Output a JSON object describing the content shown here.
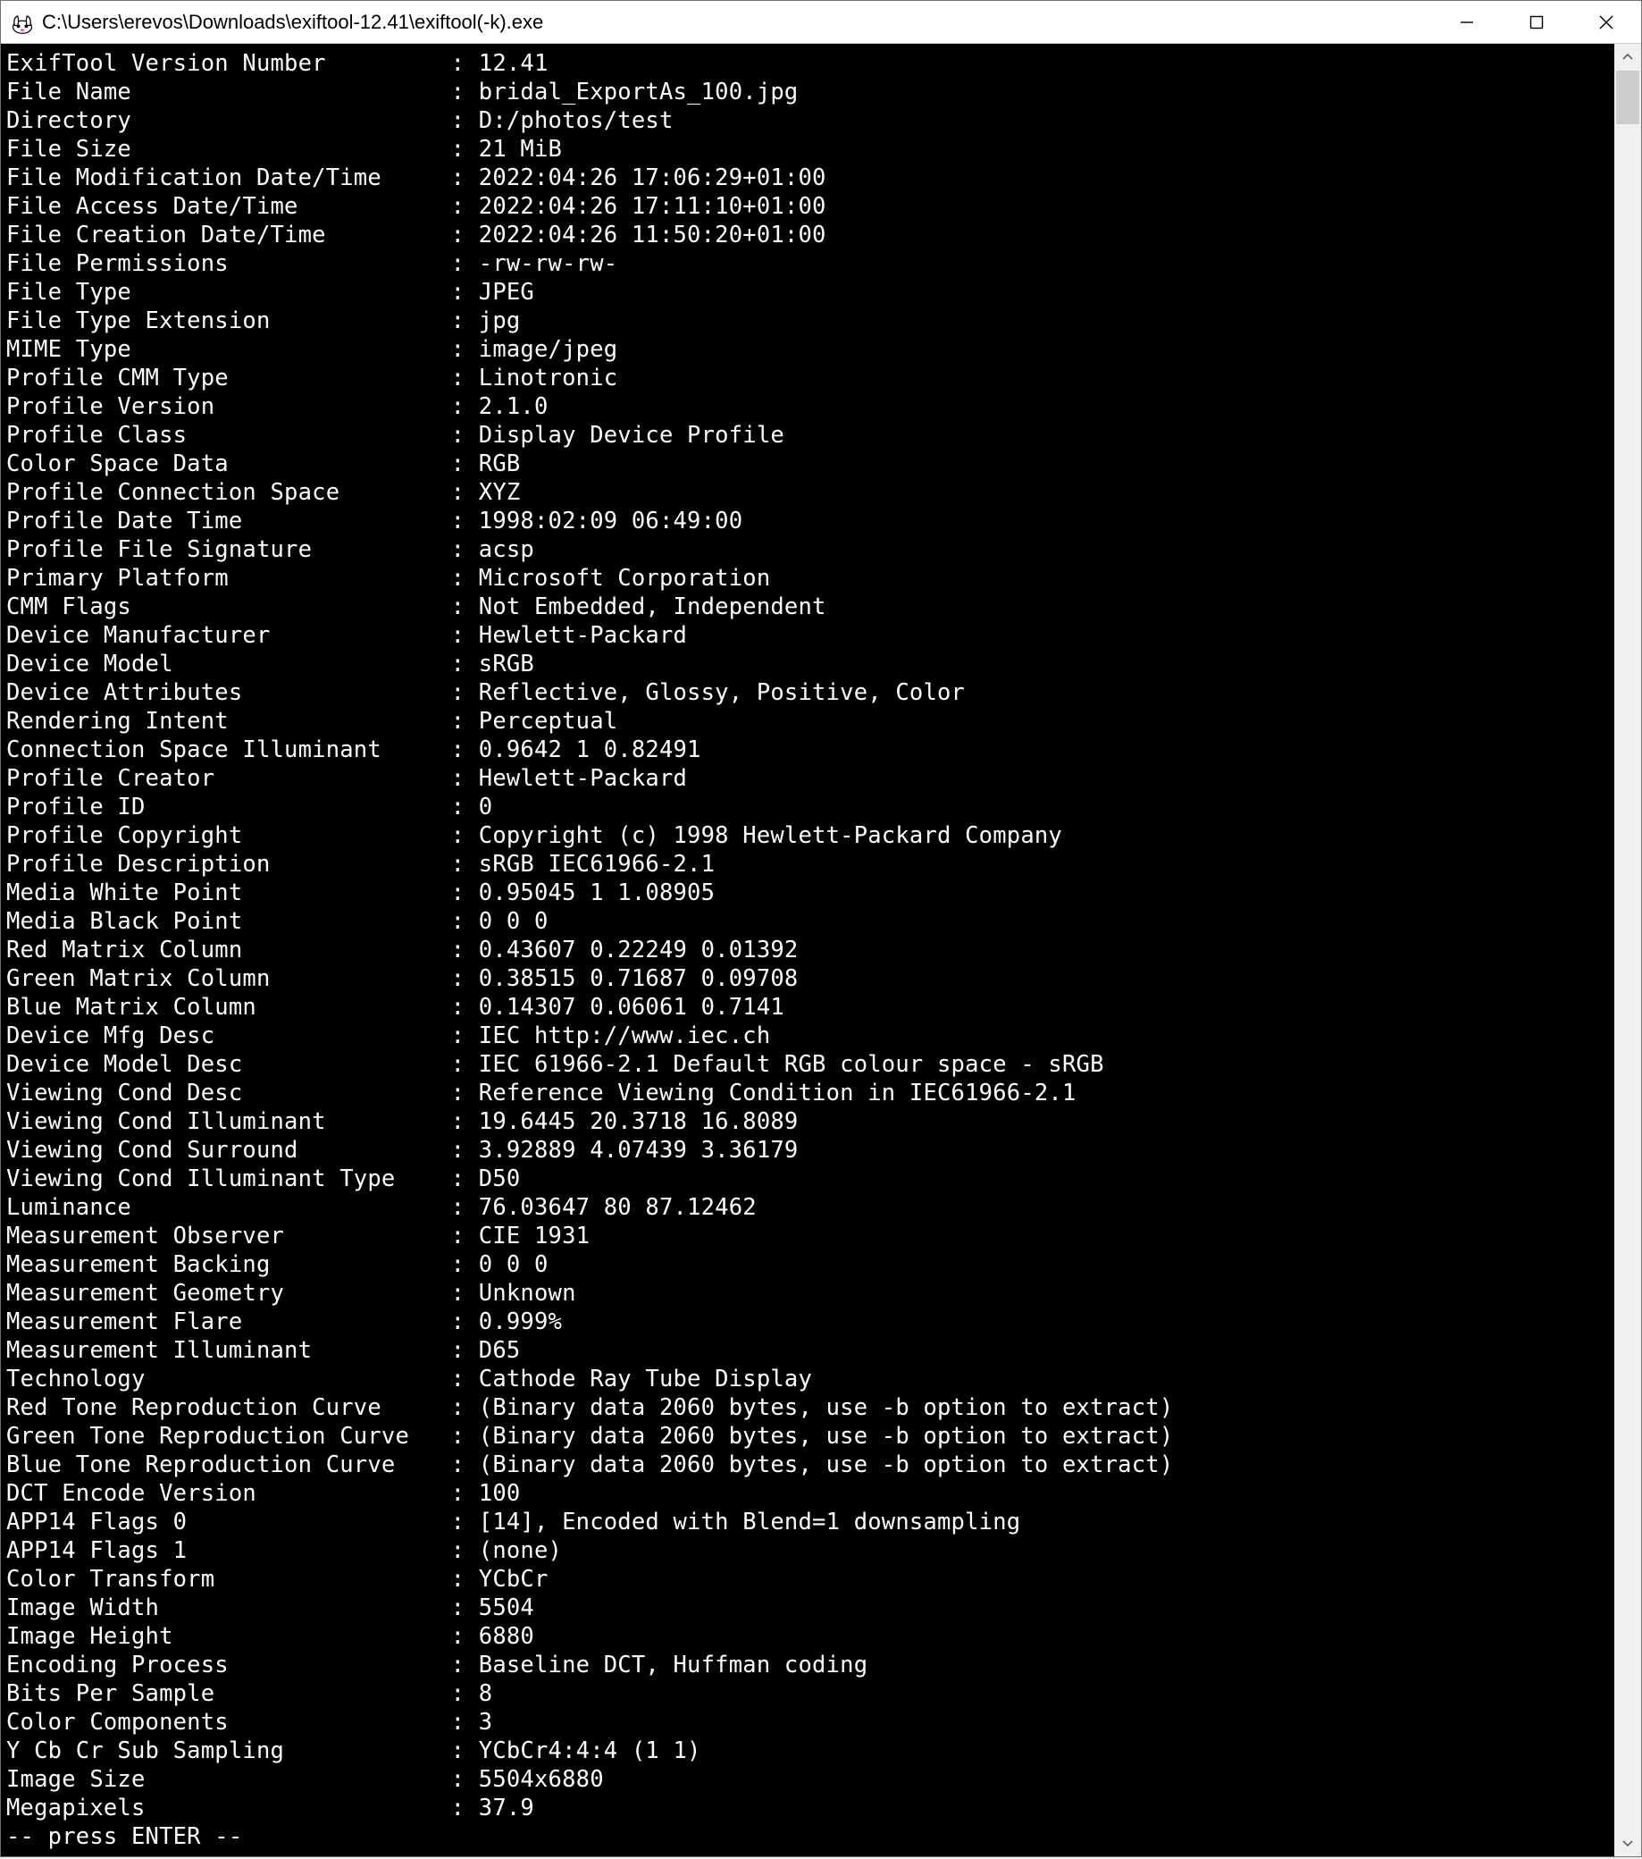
{
  "window": {
    "title": "C:\\Users\\erevos\\Downloads\\exiftool-12.41\\exiftool(-k).exe"
  },
  "terminal": {
    "prompt": "-- press ENTER --",
    "rows": [
      {
        "label": "ExifTool Version Number",
        "value": "12.41"
      },
      {
        "label": "File Name",
        "value": "bridal_ExportAs_100.jpg"
      },
      {
        "label": "Directory",
        "value": "D:/photos/test"
      },
      {
        "label": "File Size",
        "value": "21 MiB"
      },
      {
        "label": "File Modification Date/Time",
        "value": "2022:04:26 17:06:29+01:00"
      },
      {
        "label": "File Access Date/Time",
        "value": "2022:04:26 17:11:10+01:00"
      },
      {
        "label": "File Creation Date/Time",
        "value": "2022:04:26 11:50:20+01:00"
      },
      {
        "label": "File Permissions",
        "value": "-rw-rw-rw-"
      },
      {
        "label": "File Type",
        "value": "JPEG"
      },
      {
        "label": "File Type Extension",
        "value": "jpg"
      },
      {
        "label": "MIME Type",
        "value": "image/jpeg"
      },
      {
        "label": "Profile CMM Type",
        "value": "Linotronic"
      },
      {
        "label": "Profile Version",
        "value": "2.1.0"
      },
      {
        "label": "Profile Class",
        "value": "Display Device Profile"
      },
      {
        "label": "Color Space Data",
        "value": "RGB"
      },
      {
        "label": "Profile Connection Space",
        "value": "XYZ"
      },
      {
        "label": "Profile Date Time",
        "value": "1998:02:09 06:49:00"
      },
      {
        "label": "Profile File Signature",
        "value": "acsp"
      },
      {
        "label": "Primary Platform",
        "value": "Microsoft Corporation"
      },
      {
        "label": "CMM Flags",
        "value": "Not Embedded, Independent"
      },
      {
        "label": "Device Manufacturer",
        "value": "Hewlett-Packard"
      },
      {
        "label": "Device Model",
        "value": "sRGB"
      },
      {
        "label": "Device Attributes",
        "value": "Reflective, Glossy, Positive, Color"
      },
      {
        "label": "Rendering Intent",
        "value": "Perceptual"
      },
      {
        "label": "Connection Space Illuminant",
        "value": "0.9642 1 0.82491"
      },
      {
        "label": "Profile Creator",
        "value": "Hewlett-Packard"
      },
      {
        "label": "Profile ID",
        "value": "0"
      },
      {
        "label": "Profile Copyright",
        "value": "Copyright (c) 1998 Hewlett-Packard Company"
      },
      {
        "label": "Profile Description",
        "value": "sRGB IEC61966-2.1"
      },
      {
        "label": "Media White Point",
        "value": "0.95045 1 1.08905"
      },
      {
        "label": "Media Black Point",
        "value": "0 0 0"
      },
      {
        "label": "Red Matrix Column",
        "value": "0.43607 0.22249 0.01392"
      },
      {
        "label": "Green Matrix Column",
        "value": "0.38515 0.71687 0.09708"
      },
      {
        "label": "Blue Matrix Column",
        "value": "0.14307 0.06061 0.7141"
      },
      {
        "label": "Device Mfg Desc",
        "value": "IEC http://www.iec.ch"
      },
      {
        "label": "Device Model Desc",
        "value": "IEC 61966-2.1 Default RGB colour space - sRGB"
      },
      {
        "label": "Viewing Cond Desc",
        "value": "Reference Viewing Condition in IEC61966-2.1"
      },
      {
        "label": "Viewing Cond Illuminant",
        "value": "19.6445 20.3718 16.8089"
      },
      {
        "label": "Viewing Cond Surround",
        "value": "3.92889 4.07439 3.36179"
      },
      {
        "label": "Viewing Cond Illuminant Type",
        "value": "D50"
      },
      {
        "label": "Luminance",
        "value": "76.03647 80 87.12462"
      },
      {
        "label": "Measurement Observer",
        "value": "CIE 1931"
      },
      {
        "label": "Measurement Backing",
        "value": "0 0 0"
      },
      {
        "label": "Measurement Geometry",
        "value": "Unknown"
      },
      {
        "label": "Measurement Flare",
        "value": "0.999%"
      },
      {
        "label": "Measurement Illuminant",
        "value": "D65"
      },
      {
        "label": "Technology",
        "value": "Cathode Ray Tube Display"
      },
      {
        "label": "Red Tone Reproduction Curve",
        "value": "(Binary data 2060 bytes, use -b option to extract)"
      },
      {
        "label": "Green Tone Reproduction Curve",
        "value": "(Binary data 2060 bytes, use -b option to extract)"
      },
      {
        "label": "Blue Tone Reproduction Curve",
        "value": "(Binary data 2060 bytes, use -b option to extract)"
      },
      {
        "label": "DCT Encode Version",
        "value": "100"
      },
      {
        "label": "APP14 Flags 0",
        "value": "[14], Encoded with Blend=1 downsampling"
      },
      {
        "label": "APP14 Flags 1",
        "value": "(none)"
      },
      {
        "label": "Color Transform",
        "value": "YCbCr"
      },
      {
        "label": "Image Width",
        "value": "5504"
      },
      {
        "label": "Image Height",
        "value": "6880"
      },
      {
        "label": "Encoding Process",
        "value": "Baseline DCT, Huffman coding"
      },
      {
        "label": "Bits Per Sample",
        "value": "8"
      },
      {
        "label": "Color Components",
        "value": "3"
      },
      {
        "label": "Y Cb Cr Sub Sampling",
        "value": "YCbCr4:4:4 (1 1)"
      },
      {
        "label": "Image Size",
        "value": "5504x6880"
      },
      {
        "label": "Megapixels",
        "value": "37.9"
      }
    ]
  }
}
